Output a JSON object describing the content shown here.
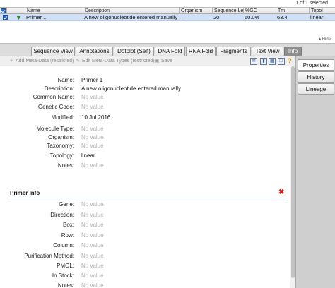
{
  "selection": {
    "count_text": "1 of 1 selected"
  },
  "table": {
    "headers": [
      {
        "key": "check",
        "label": ""
      },
      {
        "key": "type",
        "label": ""
      },
      {
        "key": "name",
        "label": "Name"
      },
      {
        "key": "desc",
        "label": "Description"
      },
      {
        "key": "organism",
        "label": "Organism"
      },
      {
        "key": "seqlen",
        "label": "Sequence Le..."
      },
      {
        "key": "gc",
        "label": "%GC"
      },
      {
        "key": "tm",
        "label": "Tm"
      },
      {
        "key": "topo",
        "label": "Topol"
      }
    ],
    "row": {
      "name": "Primer 1",
      "description": "A new oligonucleotide entered manually",
      "organism": "–",
      "sequence_length": "20",
      "gc": "60.0%",
      "tm": "63.4",
      "topology": "linear"
    },
    "hide_label": "Hide"
  },
  "tabs": [
    "Sequence View",
    "Annotations",
    "Dotplot (Self)",
    "DNA Fold",
    "RNA Fold",
    "Fragments",
    "Text View",
    "Info"
  ],
  "active_tab": "Info",
  "toolbar": {
    "add_meta": "Add Meta-Data (restricted)",
    "edit_meta": "Edit Meta-Data Types (restricted)",
    "save": "Save"
  },
  "fields": [
    {
      "label": "Name:",
      "value": "Primer 1",
      "empty": false
    },
    {
      "label": "Description:",
      "value": "A new oligonucleotide entered manually",
      "empty": false
    },
    {
      "label": "Common Name:",
      "value": "No value",
      "empty": true
    },
    {
      "label": "Genetic Code:",
      "value": "No value",
      "empty": true
    },
    {
      "label": "Modified:",
      "value": "10 Jul 2016",
      "empty": false
    },
    {
      "label": "Molecule Type:",
      "value": "No value",
      "empty": true
    },
    {
      "label": "Organism:",
      "value": "No value",
      "empty": true
    },
    {
      "label": "Taxonomy:",
      "value": "No value",
      "empty": true
    },
    {
      "label": "Topology:",
      "value": "linear",
      "empty": false
    },
    {
      "label": "Notes:",
      "value": "No value",
      "empty": true
    }
  ],
  "primer_section": {
    "title": "Primer Info"
  },
  "primer_fields": [
    {
      "label": "Gene:",
      "value": "No value"
    },
    {
      "label": "Direction:",
      "value": "No value"
    },
    {
      "label": "Box:",
      "value": "No value"
    },
    {
      "label": "Row:",
      "value": "No value"
    },
    {
      "label": "Column:",
      "value": "No value"
    },
    {
      "label": "Purification Method:",
      "value": "No value"
    },
    {
      "label": "PMOL:",
      "value": "No value"
    },
    {
      "label": "In Stock:",
      "value": "No value"
    },
    {
      "label": "Notes:",
      "value": "No value"
    }
  ],
  "side_tabs": [
    "Properties",
    "History",
    "Lineage"
  ],
  "active_side_tab": "Properties",
  "colors": {
    "accent": "#2a6bd1",
    "selected_row": "#cfe0f7",
    "delete": "#d01818"
  }
}
